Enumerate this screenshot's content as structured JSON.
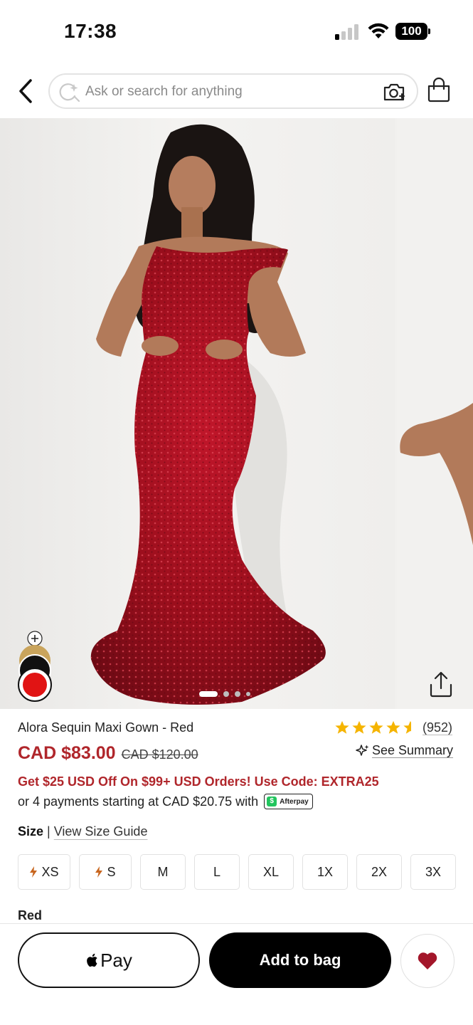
{
  "status_bar": {
    "time": "17:38",
    "battery": "100"
  },
  "search": {
    "placeholder": "Ask or search for anything"
  },
  "product": {
    "title": "Alora Sequin Maxi Gown - Red",
    "rating_count": "(952)",
    "rating": 4.5,
    "price": "CAD $83.00",
    "original_price": "CAD $120.00",
    "see_summary": "See Summary",
    "promo": "Get $25 USD Off On $99+ USD Orders! Use Code: EXTRA25",
    "installments": "or 4 payments starting at CAD $20.75 with",
    "afterpay_label": "Afterpay",
    "size_label": "Size",
    "size_guide": "View Size Guide",
    "sizes": [
      "XS",
      "S",
      "M",
      "L",
      "XL",
      "1X",
      "2X",
      "3X"
    ],
    "color": "Red",
    "accent_color": "#b0262b",
    "dress_color": "#9e0f1a"
  },
  "gallery": {
    "total_images": 4,
    "current_index": 1
  },
  "actions": {
    "apple_pay": "Pay",
    "add_to_bag": "Add to bag"
  },
  "icons": {
    "back": "chevron-left-icon",
    "search_ai": "ai-sparkle-icon",
    "camera": "camera-search-icon",
    "bag": "shopping-bag-icon",
    "share": "share-icon",
    "wishlist": "heart-icon"
  }
}
